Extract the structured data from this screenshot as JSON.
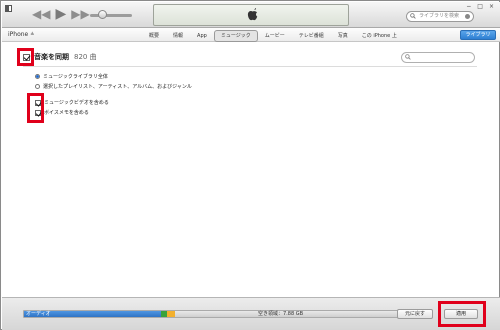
{
  "player": {
    "controls": [
      "◀◀",
      "▶",
      "▶▶"
    ],
    "volume_level": 0.25,
    "search_placeholder": "ライブラリを検索",
    "window_controls": [
      "−",
      "□",
      "×"
    ]
  },
  "device": {
    "name": "iPhone",
    "eject_glyph": "≜"
  },
  "tabs": [
    {
      "label": "概要",
      "active": false
    },
    {
      "label": "情報",
      "active": false
    },
    {
      "label": "App",
      "active": false
    },
    {
      "label": "ミュージック",
      "active": true
    },
    {
      "label": "ムービー",
      "active": false
    },
    {
      "label": "テレビ番組",
      "active": false
    },
    {
      "label": "写真",
      "active": false
    },
    {
      "label": "この iPhone 上",
      "active": false
    }
  ],
  "library_button": "ライブラリ",
  "sync": {
    "label": "音楽を同期",
    "count": "820 曲",
    "checked": true
  },
  "options": {
    "entire_library": "ミュージックライブラリ全体",
    "selected_items": "選択したプレイリスト、アーティスト、アルバム、およびジャンル",
    "include_videos": "ミュージックビデオを含める",
    "include_voice_memos": "ボイスメモを含める"
  },
  "capacity": {
    "audio_label": "オーディオ",
    "free_label": "空き領域：7.88 GB"
  },
  "buttons": {
    "revert": "元に戻す",
    "apply": "適用"
  },
  "colors": {
    "highlight": "#e0001b",
    "audio": "#3f86d8",
    "accent": "#2e7fd2"
  }
}
